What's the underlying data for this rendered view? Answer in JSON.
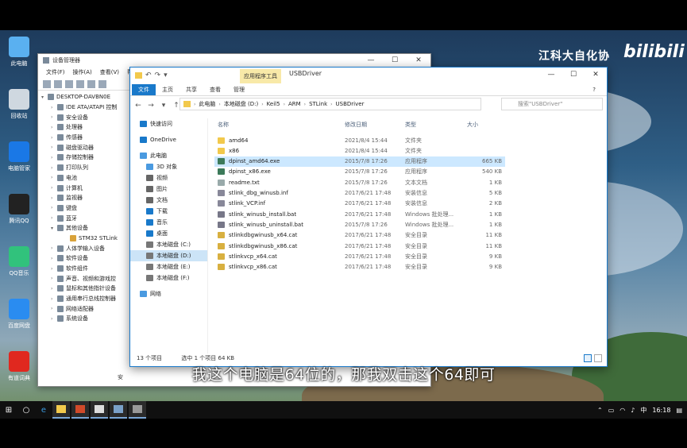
{
  "watermark": {
    "text": "江科大自化协",
    "logo": "bilibili"
  },
  "desktop_icons": [
    {
      "label": "此电脑",
      "icon": "computer-icon",
      "color": "#5ab0f0"
    },
    {
      "label": "回收站",
      "icon": "recycle-bin-icon",
      "color": "#cfd8e0"
    },
    {
      "label": "电脑管家",
      "icon": "shield-icon",
      "color": "#1a78e6"
    },
    {
      "label": "腾讯QQ",
      "icon": "qq-penguin-icon",
      "color": "#222222"
    },
    {
      "label": "QQ音乐",
      "icon": "music-icon",
      "color": "#31c27c"
    },
    {
      "label": "百度网盘",
      "icon": "cloud-drive-icon",
      "color": "#2a8cf0"
    },
    {
      "label": "有道词典",
      "icon": "dictionary-icon",
      "color": "#e0281f"
    }
  ],
  "device_manager": {
    "title": "设备管理器",
    "menu": [
      "文件(F)",
      "操作(A)",
      "查看(V)",
      "帮助(H)"
    ],
    "root": "DESKTOP-DAVBN0E",
    "items": [
      "IDE ATA/ATAPI 控制",
      "安全设备",
      "处理器",
      "传感器",
      "磁盘驱动器",
      "存储控制器",
      "打印队列",
      "电池",
      "计算机",
      "监视器",
      "键盘",
      "蓝牙",
      "其他设备",
      "STM32 STLink",
      "人体学输入设备",
      "软件设备",
      "软件组件",
      "声音、视频和游戏控",
      "鼠标和其他指针设备",
      "通用串行总线控制器",
      "网络适配器",
      "系统设备"
    ],
    "status": "安"
  },
  "explorer": {
    "title": "USBDriver",
    "context_tab": "应用程序工具",
    "ribbon": [
      "文件",
      "主页",
      "共享",
      "查看",
      "管理"
    ],
    "path": [
      "此电脑",
      "本地磁盘 (D:)",
      "Keil5",
      "ARM",
      "STLink",
      "USBDriver"
    ],
    "search_placeholder": "搜索\"USBDriver\"",
    "nav": [
      {
        "label": "快速访问",
        "icon": "star-icon",
        "color": "#1979ca"
      },
      {
        "label": "OneDrive",
        "icon": "onedrive-icon",
        "color": "#1979ca"
      },
      {
        "label": "此电脑",
        "icon": "computer-icon",
        "color": "#4a9ae0"
      },
      {
        "label": "3D 对象",
        "icon": "cube-icon",
        "color": "#4a9ae0"
      },
      {
        "label": "视频",
        "icon": "video-icon",
        "color": "#666"
      },
      {
        "label": "图片",
        "icon": "picture-icon",
        "color": "#666"
      },
      {
        "label": "文档",
        "icon": "document-icon",
        "color": "#666"
      },
      {
        "label": "下载",
        "icon": "download-icon",
        "color": "#1979ca"
      },
      {
        "label": "音乐",
        "icon": "music-icon",
        "color": "#1979ca"
      },
      {
        "label": "桌面",
        "icon": "desktop-icon",
        "color": "#1979ca"
      },
      {
        "label": "本地磁盘 (C:)",
        "icon": "drive-icon",
        "color": "#777"
      },
      {
        "label": "本地磁盘 (D:)",
        "icon": "drive-icon",
        "color": "#777"
      },
      {
        "label": "本地磁盘 (E:)",
        "icon": "drive-icon",
        "color": "#777"
      },
      {
        "label": "本地磁盘 (F:)",
        "icon": "drive-icon",
        "color": "#777"
      },
      {
        "label": "网络",
        "icon": "network-icon",
        "color": "#4a9ae0"
      }
    ],
    "columns": [
      "名称",
      "修改日期",
      "类型",
      "大小"
    ],
    "files": [
      {
        "name": "amd64",
        "date": "2021/8/4 15:44",
        "type": "文件夹",
        "size": "",
        "icon": "folder-icon",
        "color": "#f2c94c"
      },
      {
        "name": "x86",
        "date": "2021/8/4 15:44",
        "type": "文件夹",
        "size": "",
        "icon": "folder-icon",
        "color": "#f2c94c"
      },
      {
        "name": "dpinst_amd64.exe",
        "date": "2015/7/8 17:26",
        "type": "应用程序",
        "size": "665 KB",
        "icon": "exe-icon",
        "color": "#3c7a5a"
      },
      {
        "name": "dpinst_x86.exe",
        "date": "2015/7/8 17:26",
        "type": "应用程序",
        "size": "540 KB",
        "icon": "exe-icon",
        "color": "#3c7a5a"
      },
      {
        "name": "readme.txt",
        "date": "2015/7/8 17:26",
        "type": "文本文档",
        "size": "1 KB",
        "icon": "text-file-icon",
        "color": "#9aa"
      },
      {
        "name": "stlink_dbg_winusb.inf",
        "date": "2017/6/21 17:48",
        "type": "安装信息",
        "size": "5 KB",
        "icon": "inf-icon",
        "color": "#889"
      },
      {
        "name": "stlink_VCP.inf",
        "date": "2017/6/21 17:48",
        "type": "安装信息",
        "size": "2 KB",
        "icon": "inf-icon",
        "color": "#889"
      },
      {
        "name": "stlink_winusb_install.bat",
        "date": "2017/6/21 17:48",
        "type": "Windows 批处理...",
        "size": "1 KB",
        "icon": "bat-icon",
        "color": "#778"
      },
      {
        "name": "stlink_winusb_uninstall.bat",
        "date": "2015/7/8 17:26",
        "type": "Windows 批处理...",
        "size": "1 KB",
        "icon": "bat-icon",
        "color": "#778"
      },
      {
        "name": "stlinkdbgwinusb_x64.cat",
        "date": "2017/6/21 17:48",
        "type": "安全目录",
        "size": "11 KB",
        "icon": "cat-icon",
        "color": "#d8b040"
      },
      {
        "name": "stlinkdbgwinusb_x86.cat",
        "date": "2017/6/21 17:48",
        "type": "安全目录",
        "size": "11 KB",
        "icon": "cat-icon",
        "color": "#d8b040"
      },
      {
        "name": "stlinkvcp_x64.cat",
        "date": "2017/6/21 17:48",
        "type": "安全目录",
        "size": "9 KB",
        "icon": "cat-icon",
        "color": "#d8b040"
      },
      {
        "name": "stlinkvcp_x86.cat",
        "date": "2017/6/21 17:48",
        "type": "安全目录",
        "size": "9 KB",
        "icon": "cat-icon",
        "color": "#d8b040"
      }
    ],
    "status_count": "13 个项目",
    "status_selected": "选中 1 个项目  64 KB"
  },
  "subtitle": "我这个电脑是64位的，那我双击这个64即可",
  "taskbar": {
    "ime": "中",
    "time": "16:18"
  }
}
